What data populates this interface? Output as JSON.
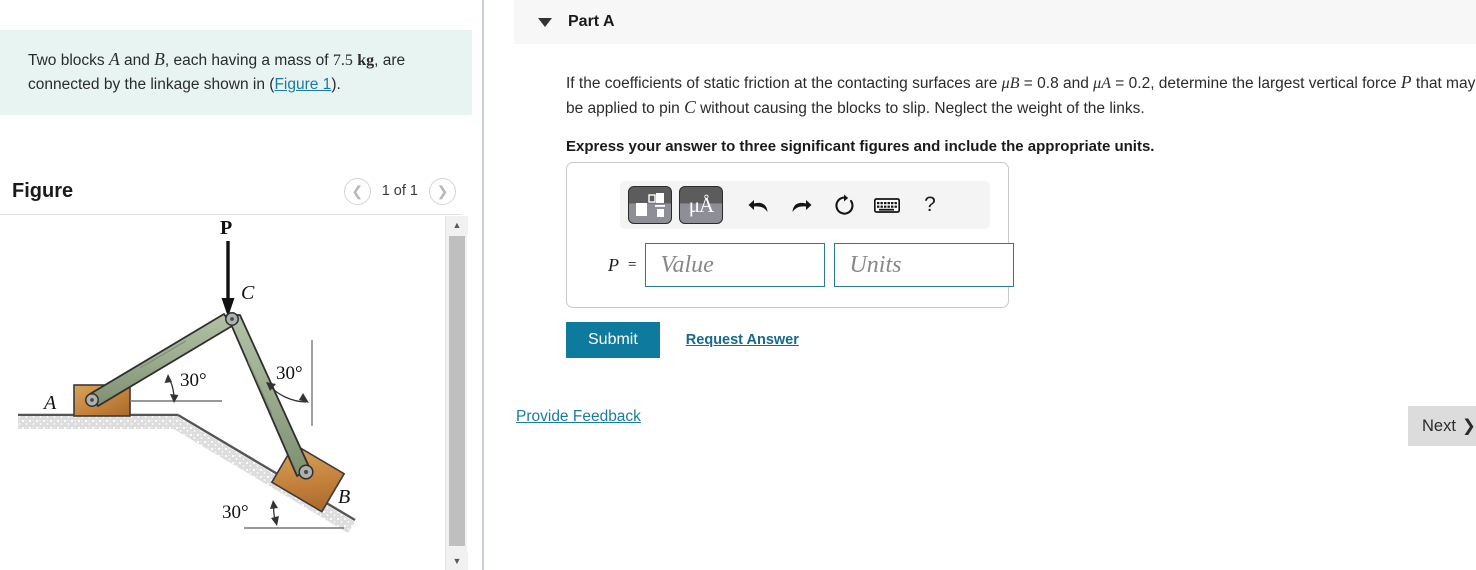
{
  "problem": {
    "line1_a": "Two blocks ",
    "var_A": "A",
    "line1_b": " and ",
    "var_B": "B",
    "line1_c": ", each having a mass of ",
    "mass_value": "7.5",
    "mass_unit": "kg",
    "line1_d": ", are connected by the linkage shown in (",
    "figure_link": "Figure 1",
    "line1_e": ")."
  },
  "figure": {
    "title": "Figure",
    "counter": "1 of 1",
    "prev_icon": "chevron-left-icon",
    "next_icon": "chevron-right-icon",
    "diagram": {
      "force_label": "P",
      "pin_c_label": "C",
      "block_a_label": "A",
      "block_b_label": "B",
      "angle_left": "30°",
      "angle_right": "30°",
      "angle_incline": "30°",
      "link_color": "#9aab8e",
      "block_color": "#c9873f",
      "ground_color": "#d8d8d8"
    }
  },
  "part": {
    "label": "Part A",
    "caret_icon": "caret-down-icon"
  },
  "question": {
    "t1": "If the coefficients of static friction at the contacting surfaces are ",
    "mu_b": "μB",
    "t2": " = 0.8 and ",
    "mu_a": "μA",
    "t3": " = 0.2, determine the largest vertical force ",
    "var_P": "P",
    "t4": " that may be applied to pin ",
    "var_C": "C",
    "t5": " without causing the blocks to slip. Neglect the weight of the links.",
    "instruction": "Express your answer to three significant figures and include the appropriate units."
  },
  "toolbar": {
    "template_icon": "template-blocks-icon",
    "units_icon": "micro-angstrom-icon",
    "units_glyph": "μÅ",
    "undo_icon": "undo-arrow-icon",
    "redo_icon": "redo-arrow-icon",
    "reset_icon": "reset-circle-icon",
    "keyboard_icon": "keyboard-icon",
    "help_icon": "help-question-icon",
    "help_glyph": "?"
  },
  "answer": {
    "prefix": "P",
    "equals": "=",
    "value_placeholder": "Value",
    "units_placeholder": "Units",
    "value_current": "",
    "units_current": "",
    "border_color": "#2a7a96"
  },
  "actions": {
    "submit_label": "Submit",
    "request_answer_label": "Request Answer",
    "feedback_label": "Provide Feedback",
    "next_label": "Next",
    "next_chevron": "❯",
    "submit_color": "#0e7a9e"
  },
  "scrollbar": {
    "up_icon": "triangle-up-icon",
    "down_icon": "triangle-down-icon"
  }
}
